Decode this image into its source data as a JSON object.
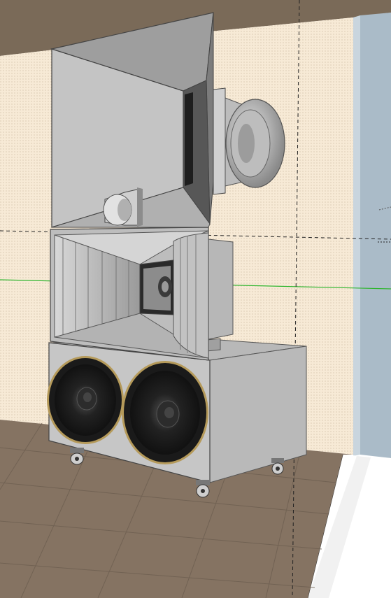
{
  "scene": {
    "subject": "speaker-cabinet-3d-model",
    "colors": {
      "ceiling": "#7a6a58",
      "wall": "#f7ead6",
      "wall_dots": "#b9a48a",
      "floor": "#857362",
      "floor_grid": "#6d5e50",
      "pillar_front": "#aabbc8",
      "pillar_side": "#c9d5de",
      "green_axis": "#2fb52f",
      "guide_line": "#222222",
      "cabinet_light": "#c9c9c9",
      "cabinet_mid": "#a9a9a9",
      "cabinet_dark": "#5e5e5e",
      "woofer_ring": "#b59a5a"
    },
    "icons": [
      "woofer",
      "woofer",
      "horn-driver",
      "compression-driver",
      "caster",
      "caster",
      "caster",
      "caster"
    ]
  }
}
